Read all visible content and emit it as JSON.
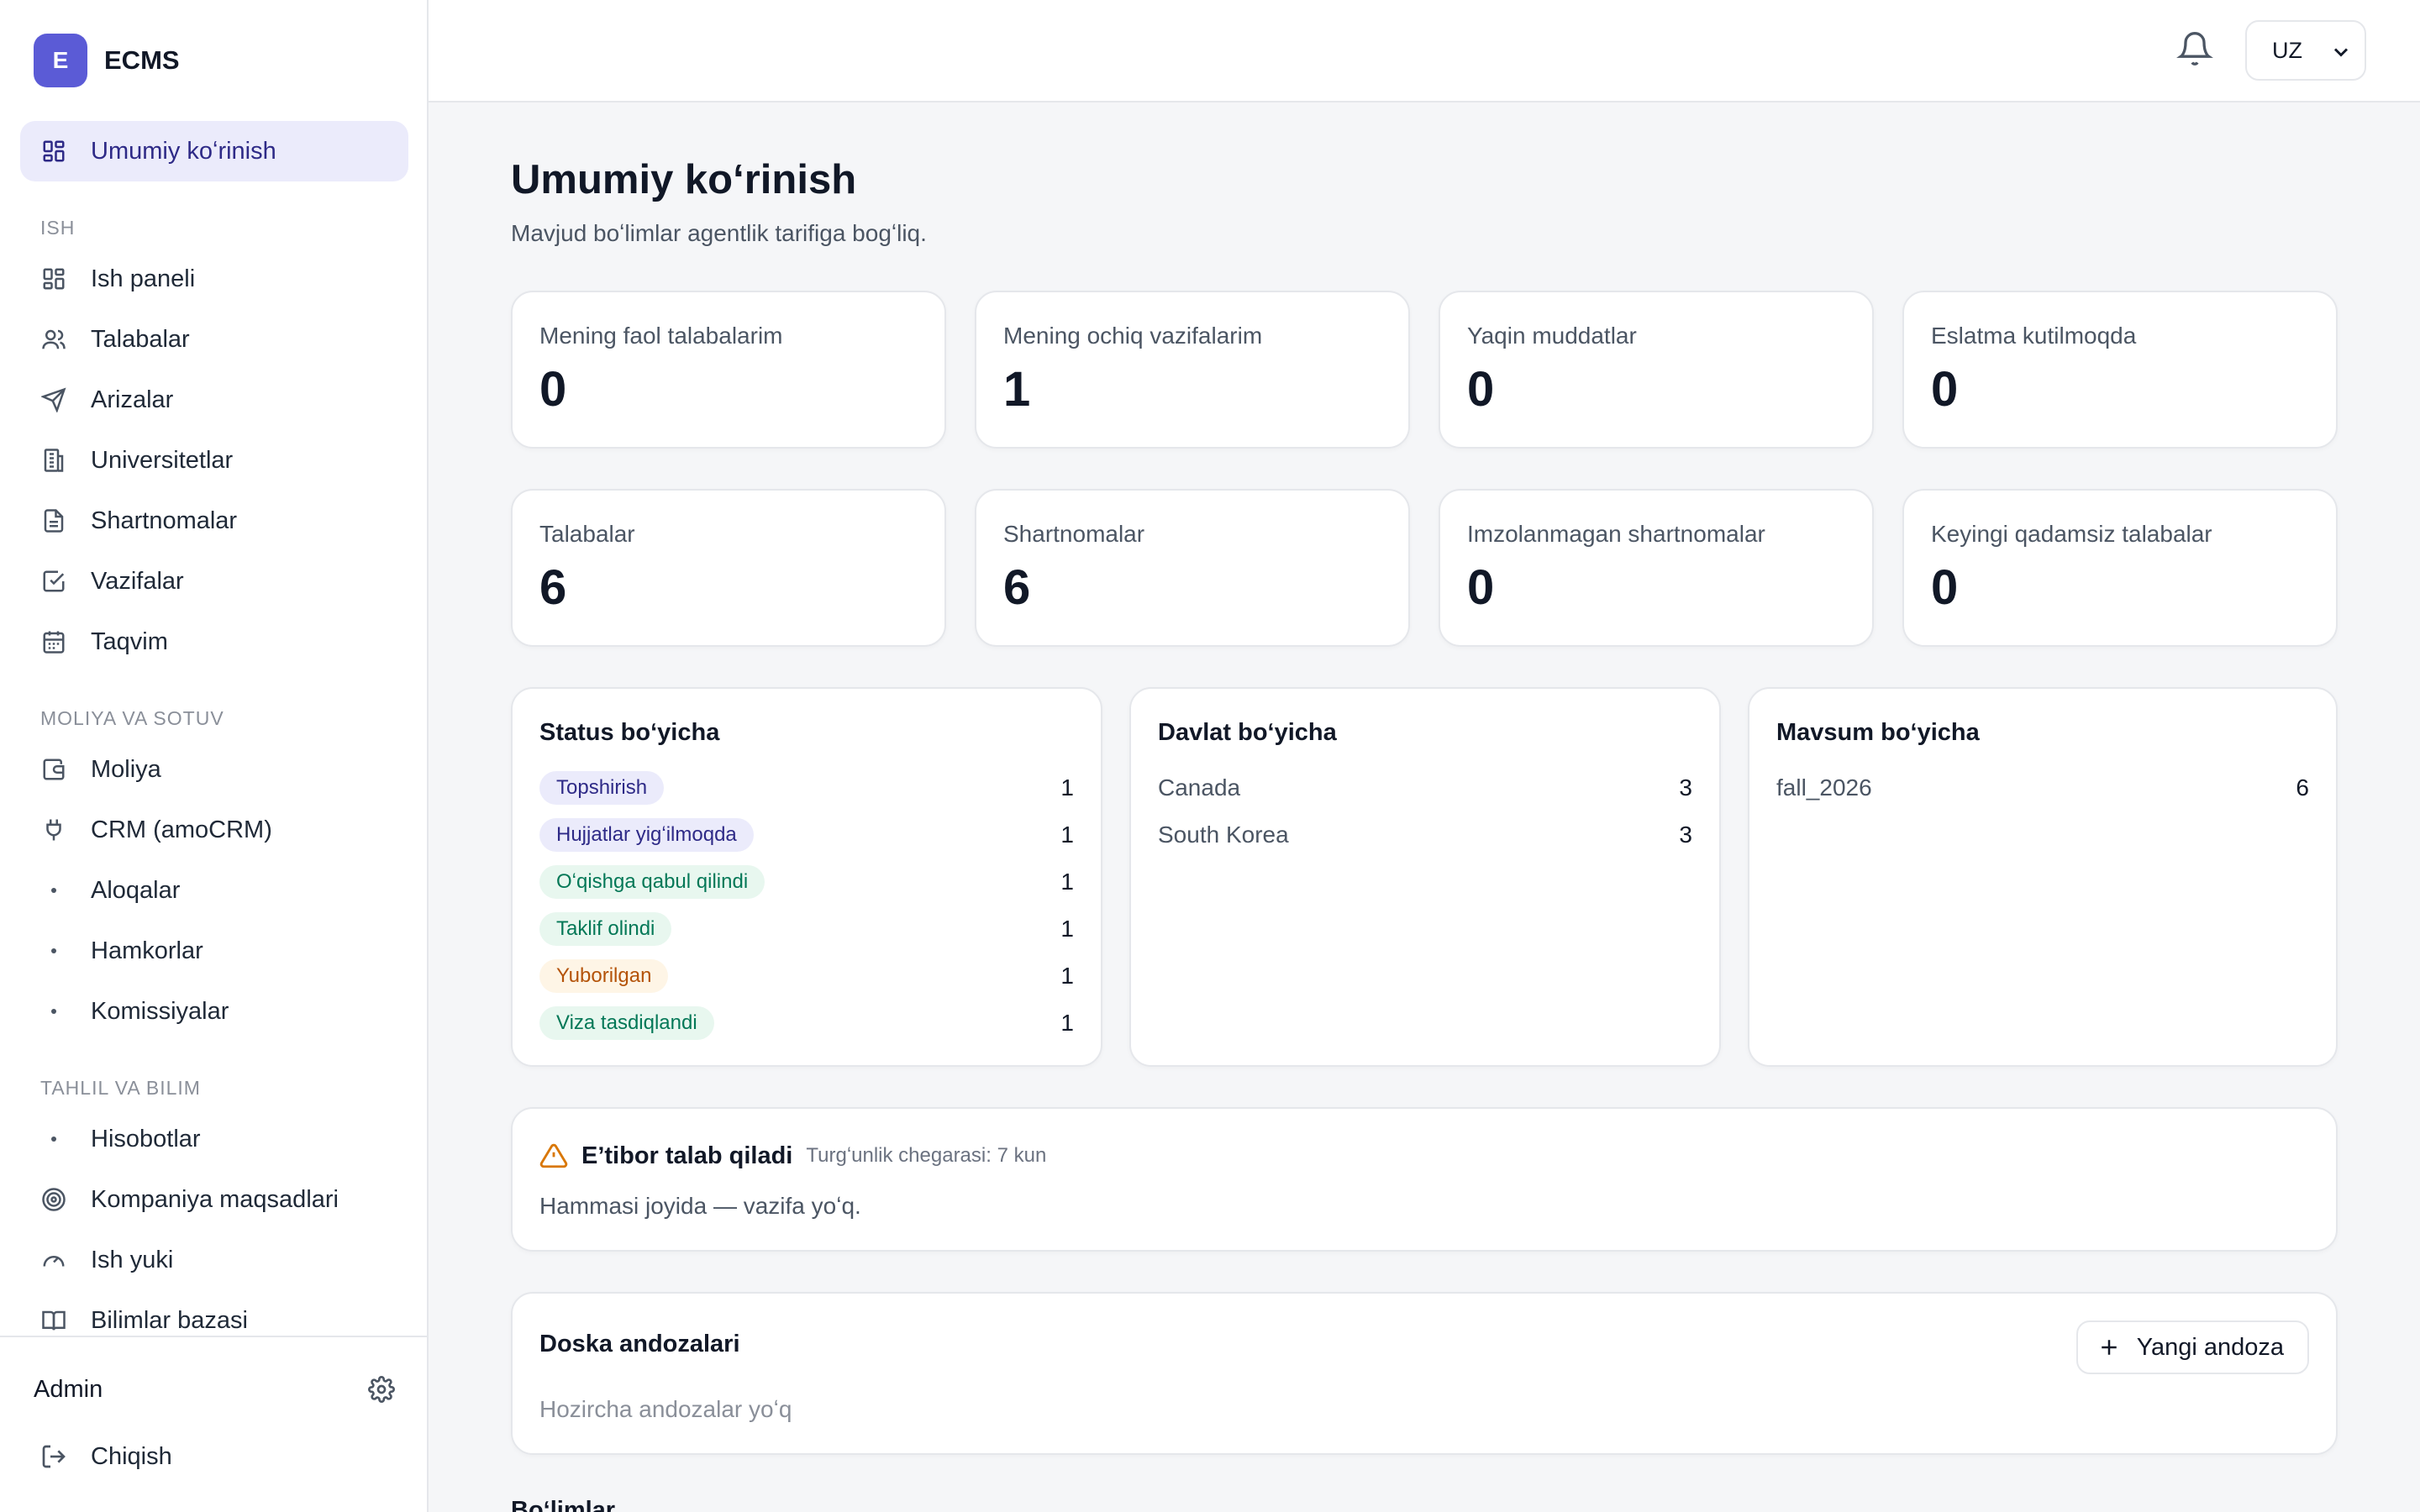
{
  "brand": {
    "logo_letter": "E",
    "name": "ECMS",
    "accent": "#5b5bd6"
  },
  "sidebar": {
    "active": {
      "label": "Umumiy koʻrinish",
      "icon": "grid-icon"
    },
    "sections": [
      {
        "title": "ISH",
        "items": [
          {
            "label": "Ish paneli",
            "icon": "grid-icon"
          },
          {
            "label": "Talabalar",
            "icon": "users-icon"
          },
          {
            "label": "Arizalar",
            "icon": "send-icon"
          },
          {
            "label": "Universitetlar",
            "icon": "building-icon"
          },
          {
            "label": "Shartnomalar",
            "icon": "document-icon"
          },
          {
            "label": "Vazifalar",
            "icon": "check-square-icon"
          },
          {
            "label": "Taqvim",
            "icon": "calendar-icon"
          }
        ]
      },
      {
        "title": "MOLIYA VA SOTUV",
        "items": [
          {
            "label": "Moliya",
            "icon": "wallet-icon"
          },
          {
            "label": "CRM (amoCRM)",
            "icon": "plug-icon"
          },
          {
            "label": "Aloqalar",
            "icon": "dot-icon"
          },
          {
            "label": "Hamkorlar",
            "icon": "dot-icon"
          },
          {
            "label": "Komissiyalar",
            "icon": "dot-icon"
          }
        ]
      },
      {
        "title": "TAHLIL VA BILIM",
        "items": [
          {
            "label": "Hisobotlar",
            "icon": "dot-icon"
          },
          {
            "label": "Kompaniya maqsadlari",
            "icon": "target-icon"
          },
          {
            "label": "Ish yuki",
            "icon": "gauge-icon"
          },
          {
            "label": "Bilimlar bazasi",
            "icon": "book-icon"
          }
        ]
      }
    ],
    "footer": {
      "user": "Admin",
      "logout": "Chiqish"
    }
  },
  "topbar": {
    "language": "UZ"
  },
  "page": {
    "title": "Umumiy koʻrinish",
    "subtitle": "Mavjud boʻlimlar agentlik tarifiga bogʻliq."
  },
  "stats_row1": [
    {
      "label": "Mening faol talabalarim",
      "value": "0"
    },
    {
      "label": "Mening ochiq vazifalarim",
      "value": "1"
    },
    {
      "label": "Yaqin muddatlar",
      "value": "0"
    },
    {
      "label": "Eslatma kutilmoqda",
      "value": "0"
    }
  ],
  "stats_row2": [
    {
      "label": "Talabalar",
      "value": "6"
    },
    {
      "label": "Shartnomalar",
      "value": "6"
    },
    {
      "label": "Imzolanmagan shartnomalar",
      "value": "0"
    },
    {
      "label": "Keyingi qadamsiz talabalar",
      "value": "0"
    }
  ],
  "by_status": {
    "title": "Status boʻyicha",
    "rows": [
      {
        "label": "Topshirish",
        "count": "1",
        "bg": "#ebebfb",
        "fg": "#2e2a87"
      },
      {
        "label": "Hujjatlar yigʻilmoqda",
        "count": "1",
        "bg": "#ebebfb",
        "fg": "#2e2a87"
      },
      {
        "label": "Oʻqishga qabul qilindi",
        "count": "1",
        "bg": "#e8f7ef",
        "fg": "#047857"
      },
      {
        "label": "Taklif olindi",
        "count": "1",
        "bg": "#e8f7ef",
        "fg": "#047857"
      },
      {
        "label": "Yuborilgan",
        "count": "1",
        "bg": "#fef5e6",
        "fg": "#b45309"
      },
      {
        "label": "Viza tasdiqlandi",
        "count": "1",
        "bg": "#e8f7ef",
        "fg": "#047857"
      }
    ]
  },
  "by_country": {
    "title": "Davlat boʻyicha",
    "rows": [
      {
        "label": "Canada",
        "count": "3"
      },
      {
        "label": "South Korea",
        "count": "3"
      }
    ]
  },
  "by_season": {
    "title": "Mavsum boʻyicha",
    "rows": [
      {
        "label": "fall_2026",
        "count": "6"
      }
    ]
  },
  "attention": {
    "title": "Eʼtibor talab qiladi",
    "threshold": "Turgʻunlik chegarasi: 7 kun",
    "message": "Hammasi joyida — vazifa yoʻq."
  },
  "templates": {
    "title": "Doska andozalari",
    "new_button": "Yangi andoza",
    "empty": "Hozircha andozalar yoʻq"
  },
  "next_section": "Boʻlimlar"
}
